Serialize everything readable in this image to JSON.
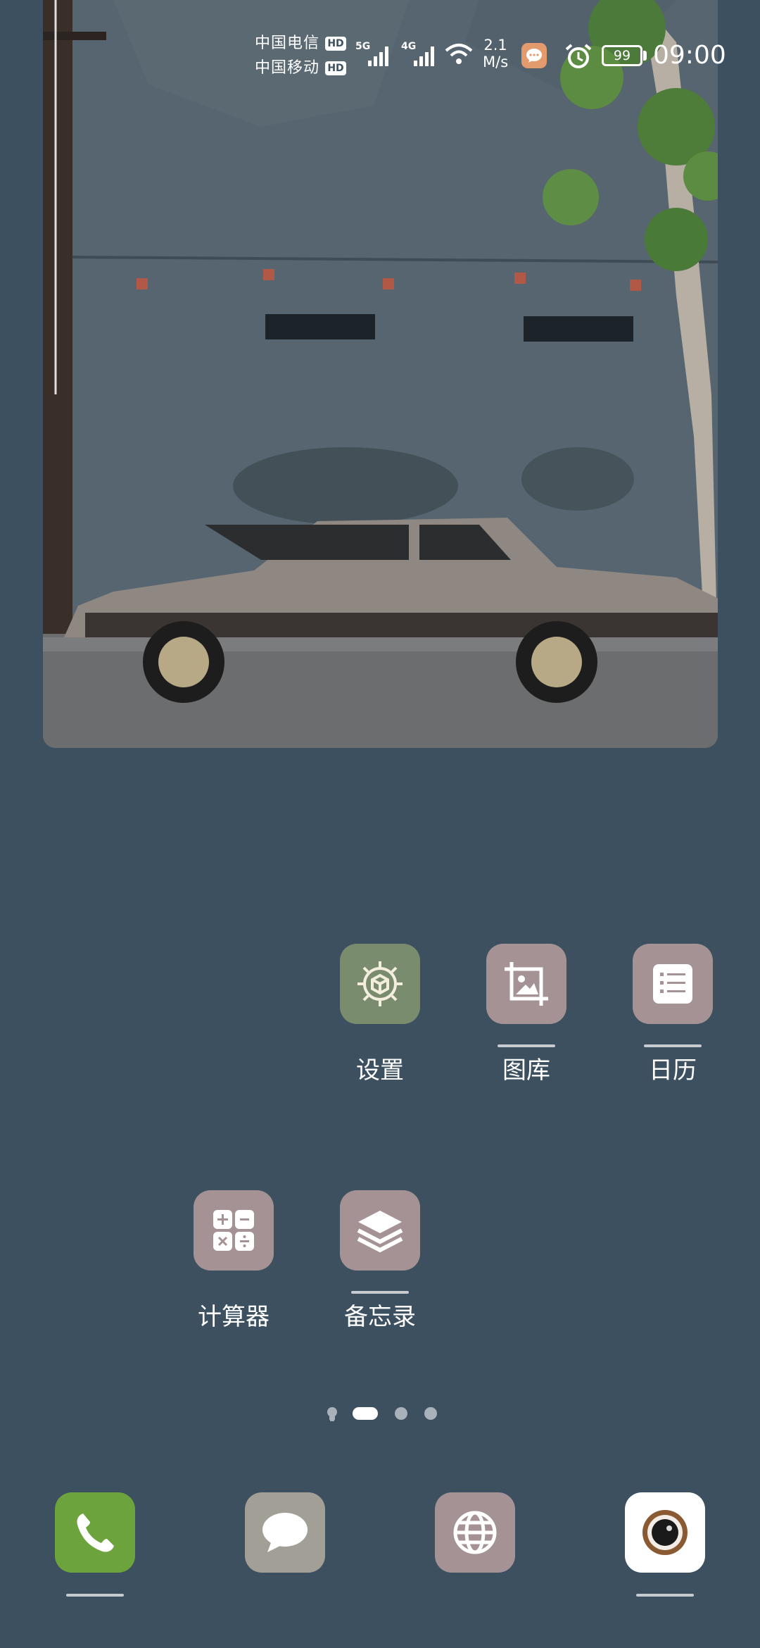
{
  "status_bar": {
    "carrier_1": "中国电信",
    "carrier_2": "中国移动",
    "hd_badge": "HD",
    "network_1": "5G",
    "network_2": "4G",
    "speed_value": "2.1",
    "speed_unit": "M/s",
    "battery": "99",
    "time": "09:00",
    "icons": [
      "signal-icon",
      "wifi-icon",
      "message-notification-icon",
      "alarm-icon",
      "battery-icon"
    ]
  },
  "wallpaper_widget": {
    "description_icon": "car-photo"
  },
  "apps": [
    {
      "name": "settings",
      "label": "设置",
      "icon": "gear-icon",
      "color": "#7a8c6e"
    },
    {
      "name": "gallery",
      "label": "图库",
      "icon": "gallery-icon",
      "color": "#a59294"
    },
    {
      "name": "calendar",
      "label": "日历",
      "icon": "list-icon",
      "color": "#a59294"
    },
    {
      "name": "calculator",
      "label": "计算器",
      "icon": "calculator-icon",
      "color": "#a59294"
    },
    {
      "name": "notes",
      "label": "备忘录",
      "icon": "layers-icon",
      "color": "#a59294"
    }
  ],
  "page_indicator": {
    "pages": 4,
    "current": 1
  },
  "dock": [
    {
      "name": "phone",
      "icon": "phone-icon",
      "color": "#6da33d"
    },
    {
      "name": "messages",
      "icon": "chat-bubble-icon",
      "color": "#a19f96"
    },
    {
      "name": "browser",
      "icon": "globe-icon",
      "color": "#a59294"
    },
    {
      "name": "camera",
      "icon": "camera-icon",
      "color": "#ffffff"
    }
  ]
}
